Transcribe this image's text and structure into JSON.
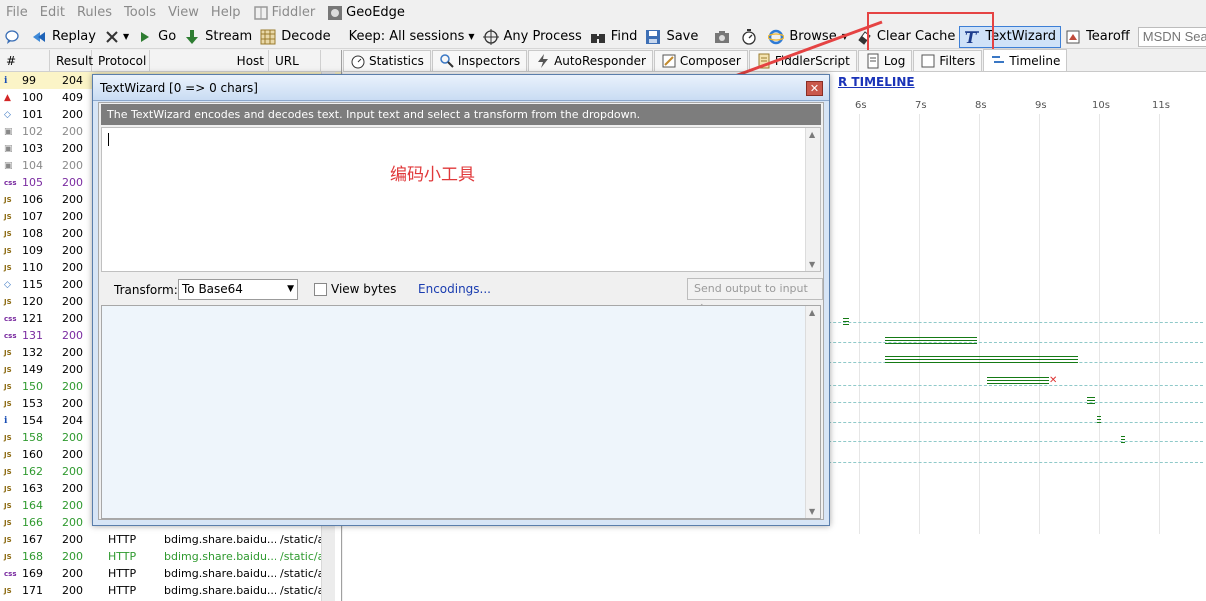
{
  "menubar": {
    "items": [
      "File",
      "Edit",
      "Rules",
      "Tools",
      "View",
      "Help",
      "Fiddler",
      "GeoEdge"
    ]
  },
  "toolbar": {
    "replay": "Replay",
    "go": "Go",
    "stream": "Stream",
    "decode": "Decode",
    "keep": "Keep: All sessions",
    "any_process": "Any Process",
    "find": "Find",
    "save": "Save",
    "browse": "Browse",
    "clear_cache": "Clear Cache",
    "textwizard": "TextWizard",
    "tearoff": "Tearoff",
    "msdn_placeholder": "MSDN Search..."
  },
  "sessions": {
    "columns": [
      "#",
      "Result",
      "Protocol",
      "Host",
      "URL"
    ],
    "rows": [
      {
        "id": "99",
        "result": "204",
        "icon": "i",
        "style": "sel"
      },
      {
        "id": "100",
        "result": "409",
        "icon": "!",
        "style": ""
      },
      {
        "id": "101",
        "result": "200",
        "icon": "<>",
        "style": ""
      },
      {
        "id": "102",
        "result": "200",
        "icon": "lock",
        "style": "gray"
      },
      {
        "id": "103",
        "result": "200",
        "icon": "lock",
        "style": ""
      },
      {
        "id": "104",
        "result": "200",
        "icon": "lock",
        "style": "gray"
      },
      {
        "id": "105",
        "result": "200",
        "icon": "css",
        "style": "purple"
      },
      {
        "id": "106",
        "result": "200",
        "icon": "js",
        "style": ""
      },
      {
        "id": "107",
        "result": "200",
        "icon": "js",
        "style": ""
      },
      {
        "id": "108",
        "result": "200",
        "icon": "js",
        "style": ""
      },
      {
        "id": "109",
        "result": "200",
        "icon": "js",
        "style": ""
      },
      {
        "id": "110",
        "result": "200",
        "icon": "js",
        "style": ""
      },
      {
        "id": "115",
        "result": "200",
        "icon": "<>",
        "style": ""
      },
      {
        "id": "120",
        "result": "200",
        "icon": "js",
        "style": ""
      },
      {
        "id": "121",
        "result": "200",
        "icon": "css",
        "style": ""
      },
      {
        "id": "131",
        "result": "200",
        "icon": "css",
        "style": "purple"
      },
      {
        "id": "132",
        "result": "200",
        "icon": "js",
        "style": ""
      },
      {
        "id": "149",
        "result": "200",
        "icon": "js",
        "style": ""
      },
      {
        "id": "150",
        "result": "200",
        "icon": "js",
        "style": "green"
      },
      {
        "id": "153",
        "result": "200",
        "icon": "js",
        "style": ""
      },
      {
        "id": "154",
        "result": "204",
        "icon": "i",
        "style": ""
      },
      {
        "id": "158",
        "result": "200",
        "icon": "js",
        "style": "green"
      },
      {
        "id": "160",
        "result": "200",
        "icon": "js",
        "style": ""
      },
      {
        "id": "162",
        "result": "200",
        "icon": "js",
        "style": "green"
      },
      {
        "id": "163",
        "result": "200",
        "icon": "js",
        "style": ""
      },
      {
        "id": "164",
        "result": "200",
        "icon": "js",
        "style": "green"
      },
      {
        "id": "166",
        "result": "200",
        "icon": "js",
        "style": "green"
      },
      {
        "id": "167",
        "result": "200",
        "protocol": "HTTP",
        "host": "bdimg.share.baidu....",
        "url": "/static/ap",
        "icon": "js",
        "style": ""
      },
      {
        "id": "168",
        "result": "200",
        "protocol": "HTTP",
        "host": "bdimg.share.baidu....",
        "url": "/static/ap",
        "icon": "js",
        "style": "green"
      },
      {
        "id": "169",
        "result": "200",
        "protocol": "HTTP",
        "host": "bdimg.share.baidu....",
        "url": "/static/ap",
        "icon": "css",
        "style": ""
      },
      {
        "id": "171",
        "result": "200",
        "protocol": "HTTP",
        "host": "bdimg.share.baidu....",
        "url": "/static/ap",
        "icon": "js",
        "style": ""
      }
    ]
  },
  "tabs": [
    "Statistics",
    "Inspectors",
    "AutoResponder",
    "Composer",
    "FiddlerScript",
    "Log",
    "Filters",
    "Timeline"
  ],
  "timeline": {
    "title": "R TIMELINE",
    "ticks": [
      "6s",
      "7s",
      "8s",
      "9s",
      "10s",
      "11s"
    ]
  },
  "dialog": {
    "title": "TextWizard [0 => 0 chars]",
    "info": "The TextWizard encodes and decodes text. Input text and select a transform from the dropdown.",
    "annotation": "编码小工具",
    "transform_label": "Transform:",
    "transform_value": "To Base64",
    "view_bytes": "View bytes",
    "encodings": "Encodings...",
    "send_output": "Send output to input"
  }
}
